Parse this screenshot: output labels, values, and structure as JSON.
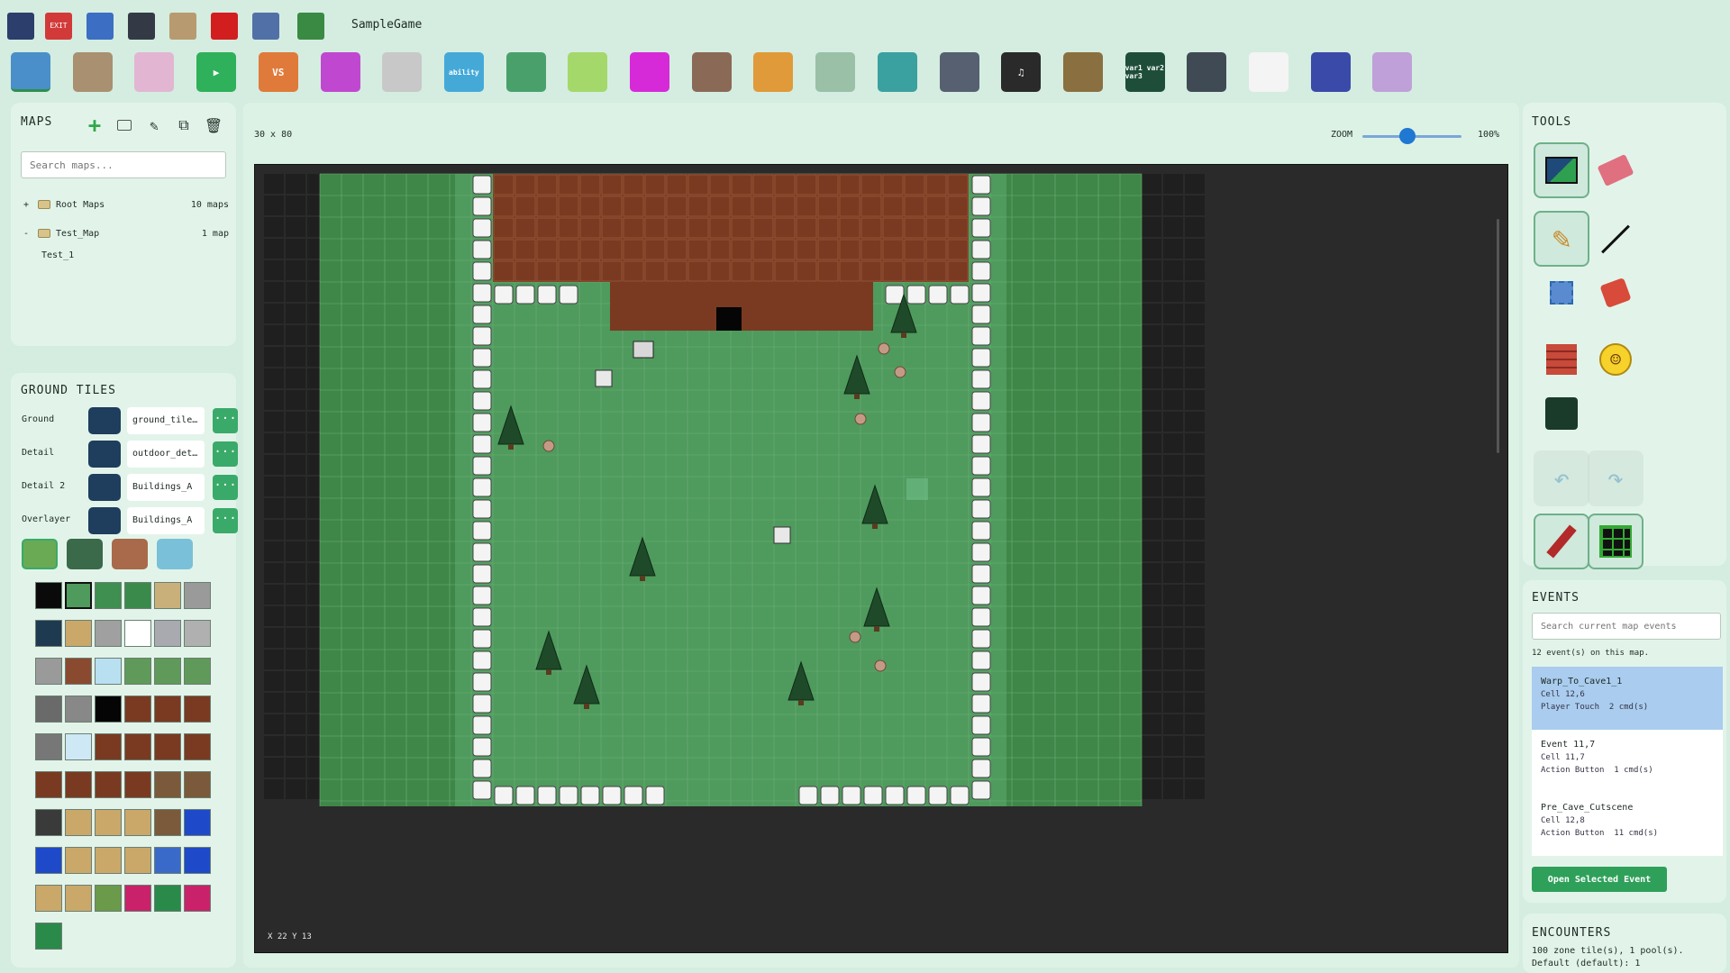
{
  "app": {
    "title": "SampleGame"
  },
  "system_icons": [
    {
      "name": "save-icon",
      "label": "",
      "bg": "#2c3e6b"
    },
    {
      "name": "exit-icon",
      "label": "EXIT",
      "bg": "#d23a3a"
    },
    {
      "name": "marker-icon",
      "label": "",
      "bg": "#3c6ec4"
    },
    {
      "name": "window-icon",
      "label": "",
      "bg": "#333a45"
    },
    {
      "name": "paint-palette-icon",
      "label": "",
      "bg": "#b89a70"
    },
    {
      "name": "adobe-icon",
      "label": "",
      "bg": "#d21e1e"
    },
    {
      "name": "grid-tool-icon",
      "label": "",
      "bg": "#5270a8"
    },
    {
      "name": "dragon-icon",
      "label": "",
      "bg": "#3a8a44"
    }
  ],
  "toolbar": [
    {
      "name": "map-editor-button",
      "label": "",
      "bg": "#4a8fc9",
      "active": true
    },
    {
      "name": "world-map-button",
      "label": "",
      "bg": "#a89070"
    },
    {
      "name": "egg-button",
      "label": "",
      "bg": "#e2b6d2"
    },
    {
      "name": "play-button",
      "label": "▶",
      "bg": "#2fb05a"
    },
    {
      "name": "versus-button",
      "label": "VS",
      "bg": "#e07a3a"
    },
    {
      "name": "fire-button",
      "label": "",
      "bg": "#c048d0"
    },
    {
      "name": "run-button",
      "label": "",
      "bg": "#c8c8c8"
    },
    {
      "name": "ability-button",
      "label": "ability",
      "bg": "#45a9d8"
    },
    {
      "name": "items-button",
      "label": "",
      "bg": "#4aa06a"
    },
    {
      "name": "potion-button",
      "label": "",
      "bg": "#a4d86a"
    },
    {
      "name": "creature-button",
      "label": "",
      "bg": "#d62ad8"
    },
    {
      "name": "characters-button",
      "label": "",
      "bg": "#8a6a56"
    },
    {
      "name": "tools-button",
      "label": "",
      "bg": "#e09a3a"
    },
    {
      "name": "tileset-button",
      "label": "",
      "bg": "#9ac0a8"
    },
    {
      "name": "shop-button",
      "label": "",
      "bg": "#3aa0a0"
    },
    {
      "name": "script-button",
      "label": "",
      "bg": "#566070"
    },
    {
      "name": "music-button",
      "label": "♫",
      "bg": "#2a2a2a"
    },
    {
      "name": "portrait-button",
      "label": "",
      "bg": "#8a7040"
    },
    {
      "name": "variables-button",
      "label": "var1 var2 var3",
      "bg": "#1e4e3a"
    },
    {
      "name": "layout-button",
      "label": "",
      "bg": "#404a55"
    },
    {
      "name": "text-button",
      "label": "",
      "bg": "#f4f4f4"
    },
    {
      "name": "effects-button",
      "label": "",
      "bg": "#3a4aa8"
    },
    {
      "name": "plugins-button",
      "label": "",
      "bg": "#c0a0d8"
    }
  ],
  "maps": {
    "title": "MAPS",
    "search_placeholder": "Search maps...",
    "tree": [
      {
        "toggle": "+",
        "folder": true,
        "label": "Root Maps",
        "count": "10 maps"
      },
      {
        "toggle": "-",
        "folder": true,
        "label": "Test_Map",
        "count": "1 map"
      },
      {
        "toggle": "",
        "folder": false,
        "label": "Test_1",
        "count": ""
      }
    ]
  },
  "ground_tiles": {
    "title": "GROUND TILES",
    "layers": [
      {
        "label": "Ground",
        "tileset": "ground_tile…",
        "more": "···"
      },
      {
        "label": "Detail",
        "tileset": "outdoor_det…",
        "more": "···"
      },
      {
        "label": "Detail 2",
        "tileset": "Buildings_A",
        "more": "···"
      },
      {
        "label": "Overlayer",
        "tileset": "Buildings_A",
        "more": "···"
      }
    ],
    "palette_colors": [
      "#0a0a0a",
      "#4f9a5d",
      "#3f8f50",
      "#3a8a4c",
      "#c9b07a",
      "#9a9a9a",
      "#1e3a50",
      "#c9a86a",
      "#a0a0a0",
      "#ffffff",
      "#a8aab0",
      "#b0b0b0",
      "#9a9a9a",
      "#8a4a30",
      "#b8e0f0",
      "#5f9a5a",
      "#5f9a5a",
      "#5f9a5a",
      "#6a6a6a",
      "#888888",
      "#050505",
      "#7a3a22",
      "#7a3a22",
      "#7a3a22",
      "#777777",
      "#cfe8f5",
      "#7a3a22",
      "#7a3a22",
      "#7a3a22",
      "#7a3a22",
      "#7a3a22",
      "#7a3a22",
      "#7a3a22",
      "#7a3a22",
      "#7a5a3a",
      "#7a5a3a",
      "#3a3a3a",
      "#c9a86a",
      "#c9a86a",
      "#c9a86a",
      "#7a5a3a",
      "#1e4ac9",
      "#1e4ac9",
      "#c9a86a",
      "#c9a86a",
      "#c9a86a",
      "#3a6ac9",
      "#1e4ac9",
      "#c9a86a",
      "#c9a86a",
      "#6a9a4a",
      "#c9226a",
      "#2a8a4a",
      "#c9226a",
      "#2a8a4a"
    ]
  },
  "editor": {
    "map_size": "30 x 80",
    "zoom_label": "ZOOM",
    "zoom_value": "100%",
    "zoom_fraction": 0.45,
    "coords": "X 22   Y 13"
  },
  "tools": {
    "title": "TOOLS"
  },
  "events": {
    "title": "EVENTS",
    "search_placeholder": "Search current map events",
    "count_text": "12 event(s) on this map.",
    "items": [
      {
        "name": "Warp_To_Cave1_1",
        "cell": "Cell 12,6",
        "trigger": "Player Touch",
        "cmds": "2 cmd(s)",
        "selected": true
      },
      {
        "name": "Event 11,7",
        "cell": "Cell 11,7",
        "trigger": "Action Button",
        "cmds": "1 cmd(s)",
        "selected": false
      },
      {
        "name": "Pre_Cave_Cutscene",
        "cell": "Cell 12,8",
        "trigger": "Action Button",
        "cmds": "11 cmd(s)",
        "selected": false
      }
    ],
    "open_button": "Open Selected Event"
  },
  "encounters": {
    "title": "ENCOUNTERS",
    "line1": "100 zone tile(s), 1 pool(s).",
    "line2": "Default (default): 1"
  }
}
